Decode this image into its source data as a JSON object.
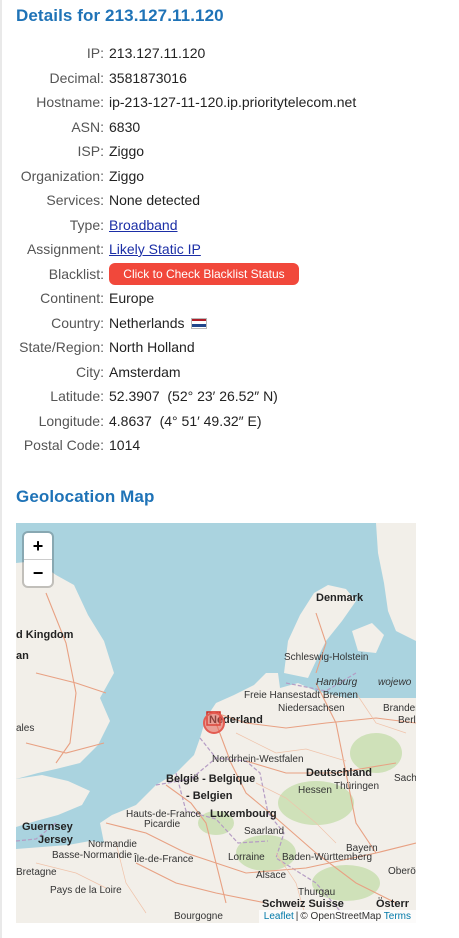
{
  "title": "Details for 213.127.11.120",
  "details": [
    {
      "label": "IP:",
      "value": "213.127.11.120"
    },
    {
      "label": "Decimal:",
      "value": "3581873016"
    },
    {
      "label": "Hostname:",
      "value": "ip-213-127-11-120.ip.prioritytelecom.net"
    },
    {
      "label": "ASN:",
      "value": "6830"
    },
    {
      "label": "ISP:",
      "value": "Ziggo"
    },
    {
      "label": "Organization:",
      "value": "Ziggo"
    },
    {
      "label": "Services:",
      "value": "None detected"
    },
    {
      "label": "Type:",
      "value": "Broadband"
    },
    {
      "label": "Assignment:",
      "value": "Likely Static IP"
    },
    {
      "label": "Blacklist:",
      "value": "Click to Check Blacklist Status"
    },
    {
      "label": "Continent:",
      "value": "Europe"
    },
    {
      "label": "Country:",
      "value": "Netherlands"
    },
    {
      "label": "State/Region:",
      "value": "North Holland"
    },
    {
      "label": "City:",
      "value": "Amsterdam"
    },
    {
      "label": "Latitude:",
      "value": "52.3907  (52° 23′ 26.52″ N)"
    },
    {
      "label": "Longitude:",
      "value": "4.8637  (4° 51′ 49.32″ E)"
    },
    {
      "label": "Postal Code:",
      "value": "1014"
    }
  ],
  "map": {
    "title": "Geolocation Map",
    "zoom_in": "+",
    "zoom_out": "−",
    "attribution": {
      "leaflet": "Leaflet",
      "sep": "|",
      "osm": "© OpenStreetMap",
      "terms": "Terms"
    },
    "labels": [
      {
        "id": "denmark",
        "text": "Denmark"
      },
      {
        "id": "kingdom",
        "text": "d Kingdom"
      },
      {
        "id": "an",
        "text": "an"
      },
      {
        "id": "schleswig",
        "text": "Schleswig-Holstein"
      },
      {
        "id": "hamburg",
        "text": "Hamburg"
      },
      {
        "id": "wojewod",
        "text": "wojewo"
      },
      {
        "id": "bremen",
        "text": "Freie Hansestadt Bremen"
      },
      {
        "id": "niedersachsen",
        "text": "Niedersachsen"
      },
      {
        "id": "branden",
        "text": "Branden"
      },
      {
        "id": "berl",
        "text": "Berl"
      },
      {
        "id": "ales",
        "text": "ales"
      },
      {
        "id": "nederland",
        "text": "Nederland"
      },
      {
        "id": "nrw",
        "text": "Nordrhein-Westfalen"
      },
      {
        "id": "belgie",
        "text": "België - Belgique"
      },
      {
        "id": "belgien",
        "text": "- Belgien"
      },
      {
        "id": "deutschland",
        "text": "Deutschland"
      },
      {
        "id": "sachs",
        "text": "Sachs"
      },
      {
        "id": "hessen",
        "text": "Hessen"
      },
      {
        "id": "thuringen",
        "text": "Thüringen"
      },
      {
        "id": "hautsdefrance",
        "text": "Hauts-de-France"
      },
      {
        "id": "picardie",
        "text": "Picardie"
      },
      {
        "id": "luxembourg",
        "text": "Luxembourg"
      },
      {
        "id": "saarland",
        "text": "Saarland"
      },
      {
        "id": "guernsey",
        "text": "Guernsey"
      },
      {
        "id": "jersey",
        "text": "Jersey"
      },
      {
        "id": "normandie",
        "text": "Normandie"
      },
      {
        "id": "bassenormandie",
        "text": "Basse-Normandie"
      },
      {
        "id": "iledefrance",
        "text": "Île-de-France"
      },
      {
        "id": "lorraine",
        "text": "Lorraine"
      },
      {
        "id": "bayern",
        "text": "Bayern"
      },
      {
        "id": "bw",
        "text": "Baden-Württemberg"
      },
      {
        "id": "bretagne",
        "text": "Bretagne"
      },
      {
        "id": "alsace",
        "text": "Alsace"
      },
      {
        "id": "obero",
        "text": "Oberö"
      },
      {
        "id": "paysdelaloire",
        "text": "Pays de la Loire"
      },
      {
        "id": "thurgau",
        "text": "Thurgau"
      },
      {
        "id": "schweiz",
        "text": "Schweiz Suisse"
      },
      {
        "id": "osterr",
        "text": "Österr"
      },
      {
        "id": "bourgogne",
        "text": "Bourgogne"
      }
    ],
    "colors": {
      "sea": "#aad3df",
      "land": "#f2efe9",
      "forest": "#cfe1b9",
      "road": "#e8a183",
      "marker": "#e35c52"
    }
  }
}
